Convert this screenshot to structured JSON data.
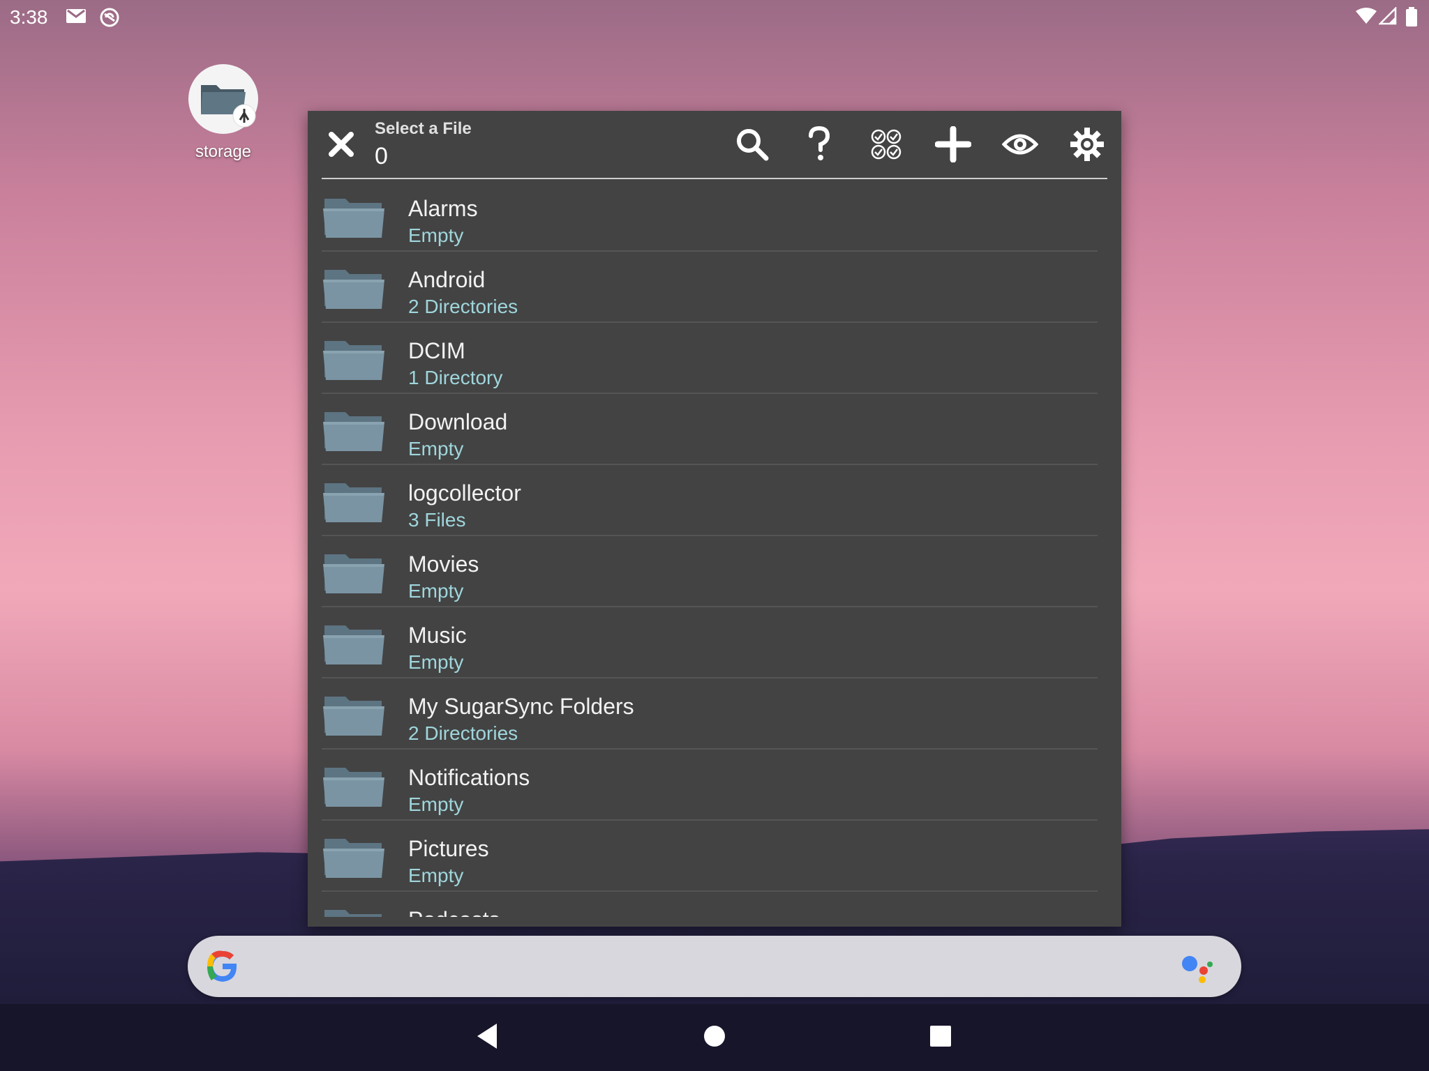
{
  "status_bar": {
    "time": "3:38"
  },
  "desktop": {
    "icon_label": "storage"
  },
  "dialog": {
    "title": "Select a File",
    "count": "0",
    "items": [
      {
        "name": "Alarms",
        "detail": "Empty"
      },
      {
        "name": "Android",
        "detail": "2 Directories"
      },
      {
        "name": "DCIM",
        "detail": "1 Directory"
      },
      {
        "name": "Download",
        "detail": "Empty"
      },
      {
        "name": "logcollector",
        "detail": "3 Files"
      },
      {
        "name": "Movies",
        "detail": "Empty"
      },
      {
        "name": "Music",
        "detail": "Empty"
      },
      {
        "name": "My SugarSync Folders",
        "detail": "2 Directories"
      },
      {
        "name": "Notifications",
        "detail": "Empty"
      },
      {
        "name": "Pictures",
        "detail": "Empty"
      },
      {
        "name": "Podcasts",
        "detail": ""
      }
    ]
  },
  "colors": {
    "accent_text": "#9fd6dc",
    "dialog_bg": "#434343",
    "folder": "#7a94a3"
  }
}
